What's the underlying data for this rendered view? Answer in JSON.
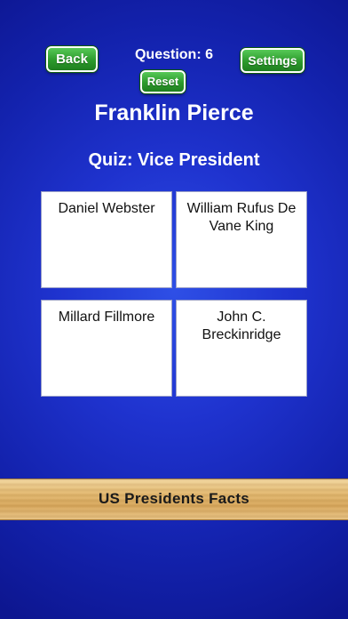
{
  "header": {
    "back_label": "Back",
    "question_label": "Question: 6",
    "settings_label": "Settings",
    "reset_label": "Reset"
  },
  "president": "Franklin Pierce",
  "quiz_title": "Quiz: Vice President",
  "answers": [
    "Daniel Webster",
    "William Rufus De Vane King",
    "Millard Fillmore",
    "John C. Breckinridge"
  ],
  "banner_text": "US Presidents Facts",
  "colors": {
    "background": "#1f33cf",
    "button_green": "#2c9a2c",
    "text": "#ffffff",
    "banner": "#e3b970"
  }
}
